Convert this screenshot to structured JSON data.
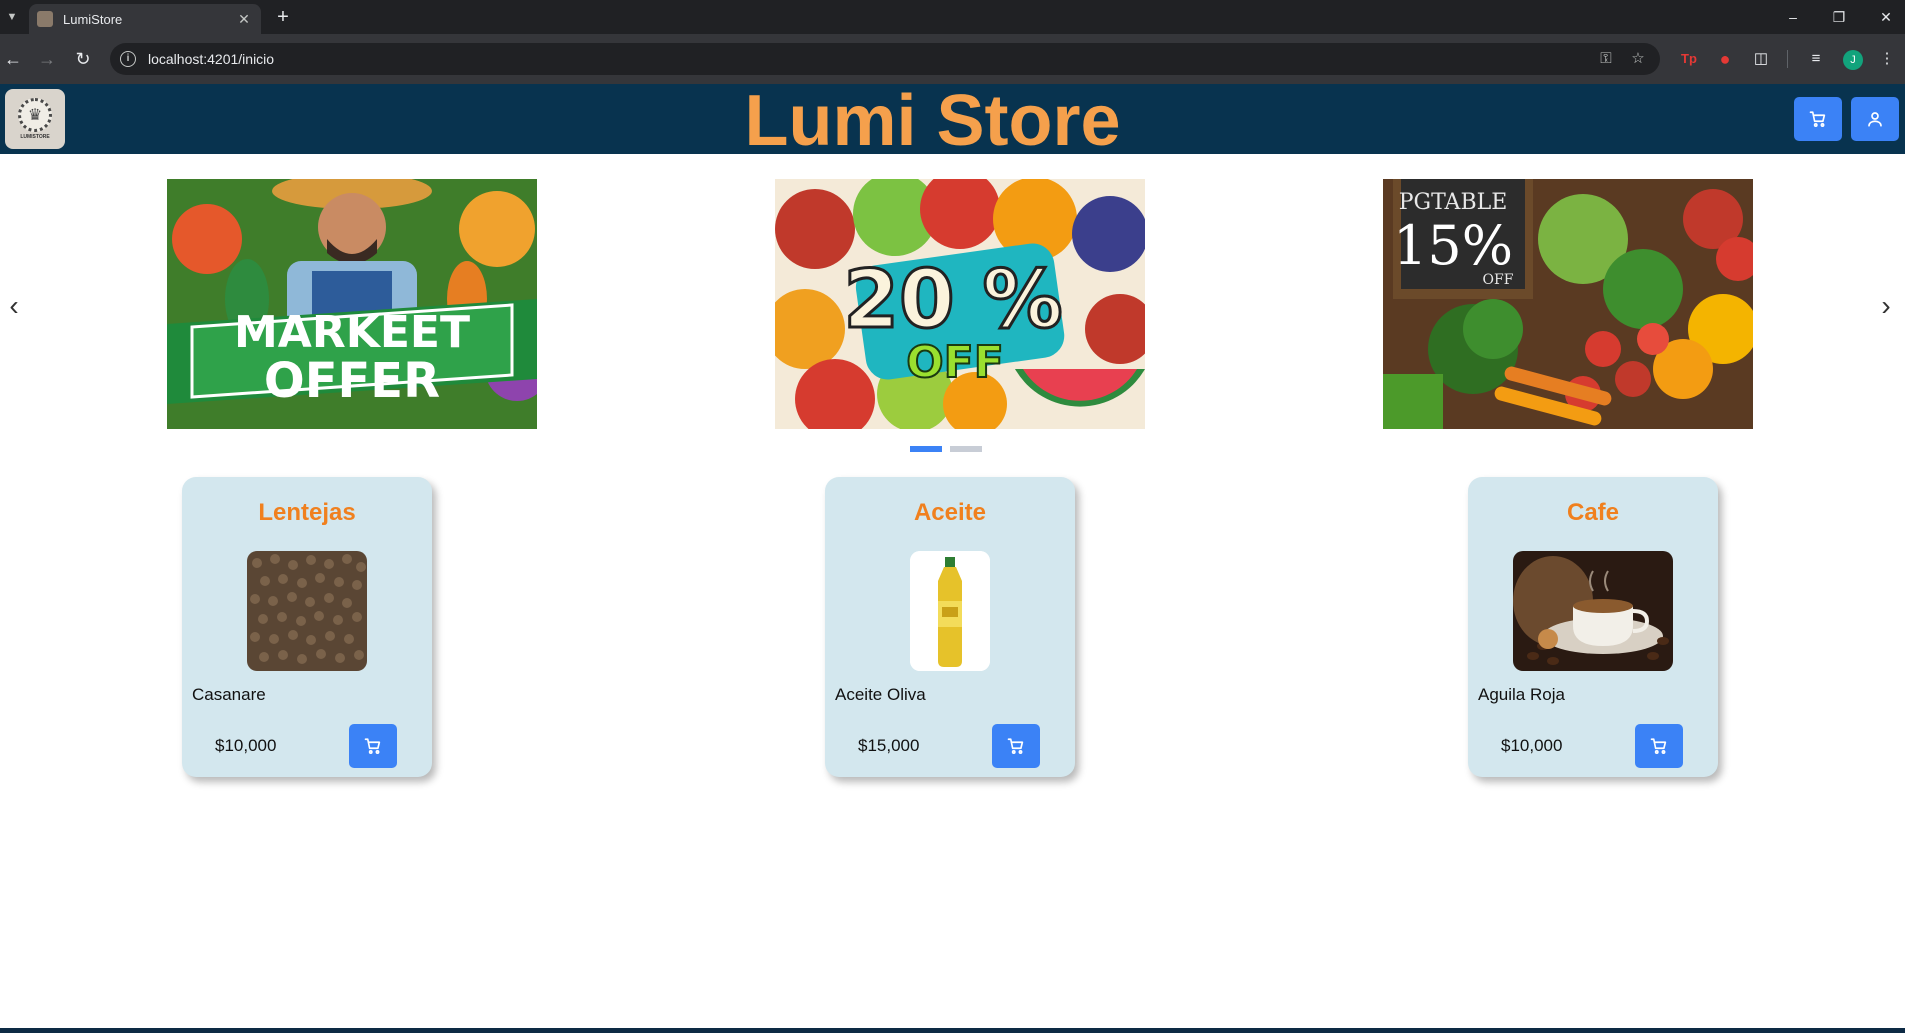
{
  "browser": {
    "tab_title": "LumiStore",
    "url": "localhost:4201/inicio",
    "profile_initial": "J",
    "extension_tp_label": "Tp"
  },
  "header": {
    "title": "Lumi Store",
    "logo_text": "LUMISTORE"
  },
  "carousel": {
    "slides": [
      {
        "caption_line1": "MARKEET",
        "caption_line2": "OFFER"
      },
      {
        "caption_line1": "20 %",
        "caption_line2": "OFF"
      },
      {
        "caption_line1": "PGTABLE",
        "caption_line2": "15%",
        "caption_line3": "OFF"
      }
    ],
    "active_index": 0,
    "indicator_count": 2
  },
  "products": [
    {
      "name": "Lentejas",
      "description": "Casanare",
      "price": "$10,000"
    },
    {
      "name": "Aceite",
      "description": "Aceite Oliva",
      "price": "$15,000"
    },
    {
      "name": "Cafe",
      "description": "Aguila Roja",
      "price": "$10,000"
    }
  ],
  "colors": {
    "header_bg": "#08334f",
    "title": "#f5a04c",
    "accent_button": "#3b82f6",
    "card_bg": "#d3e7ee",
    "card_title": "#f0801e",
    "indicator_active": "#3b82f6",
    "indicator_inactive": "#c8cdd6"
  },
  "icons": {
    "header_cart": "cart-icon",
    "header_user": "user-icon",
    "card_cart": "cart-icon"
  }
}
